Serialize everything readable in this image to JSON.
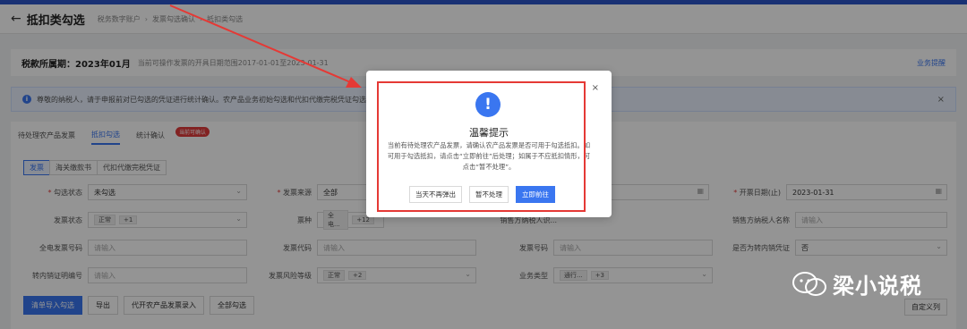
{
  "header": {
    "title": "抵扣类勾选",
    "breadcrumbs": [
      "税务数字账户",
      "发票勾选确认",
      "抵扣类勾选"
    ]
  },
  "period": {
    "label": "税款所属期：2023年01月",
    "note": "当前可操作发票的开具日期范围2017-01-01至2023-01-31",
    "link": "业务提醒"
  },
  "notice": {
    "text": "尊敬的纳税人，请于申报前对已勾选的凭证进行统计确认。农产品业务初始勾选和代扣代缴完税凭证勾选..."
  },
  "tabs": [
    {
      "label": "待处理农产品发票"
    },
    {
      "label": "抵扣勾选"
    },
    {
      "label": "统计确认"
    }
  ],
  "tab_badge": "当前可确认",
  "subtabs": [
    "发票",
    "海关缴款书",
    "代扣代缴完税凭证"
  ],
  "filters": {
    "select_status": {
      "label": "勾选状态",
      "value": "未勾选"
    },
    "invoice_source": {
      "label": "发票来源",
      "value": "全部"
    },
    "start_date": {
      "label": "开票日期(止)",
      "value": "2023-01-31"
    },
    "invoice_state": {
      "label": "发票状态",
      "value": "正常",
      "more": "+1"
    },
    "ticket_type": {
      "label": "票种",
      "value": "全电...",
      "more": "+12"
    },
    "seller_taxid": {
      "label": "销售方纳税人识...",
      "placeholder": "请输入"
    },
    "seller_name": {
      "label": "销售方纳税人名称",
      "placeholder": "请输入"
    },
    "full_invoice_no": {
      "label": "全电发票号码",
      "placeholder": "请输入"
    },
    "invoice_code": {
      "label": "发票代码",
      "placeholder": "请输入"
    },
    "invoice_no": {
      "label": "发票号码",
      "placeholder": "请输入"
    },
    "domestic_cert": {
      "label": "是否为转内销凭证",
      "value": "否"
    },
    "transfer_no": {
      "label": "转内销证明编号",
      "placeholder": "请输入"
    },
    "risk_level": {
      "label": "发票风险等级",
      "value": "正常",
      "more": "+2"
    },
    "biz_type": {
      "label": "业务类型",
      "value": "通行...",
      "more": "+3"
    }
  },
  "buttons": {
    "batch_import": "清单导入勾选",
    "export": "导出",
    "agri_entry": "代开农产品发票录入",
    "select_all": "全部勾选",
    "columns": "自定义列"
  },
  "dialog": {
    "title": "温馨提示",
    "body": "当前有待处理农产品发票，请确认农产品发票是否可用于勾选抵扣。如可用于勾选抵扣，请点击“立即前往”后处理；如属于不应抵扣情形，可点击“暂不处理”。",
    "btn_no_popup": "当天不再弹出",
    "btn_later": "暂不处理",
    "btn_go": "立即前往",
    "close": "×"
  },
  "watermark": "梁小说税",
  "colors": {
    "accent": "#3a76f0",
    "highlight": "#e53935",
    "topbar": "#2b55c8"
  }
}
